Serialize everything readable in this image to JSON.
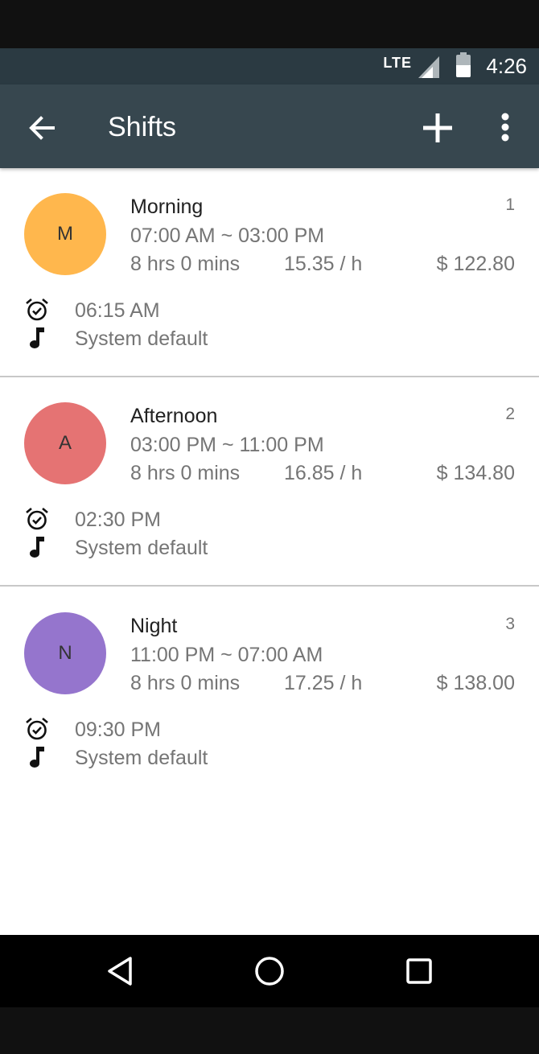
{
  "status_bar": {
    "network": "LTE",
    "time": "4:26"
  },
  "app_bar": {
    "title": "Shifts"
  },
  "shifts": [
    {
      "initial": "M",
      "name": "Morning",
      "index": "1",
      "time_range": "07:00 AM ~ 03:00 PM",
      "duration": "8 hrs 0 mins",
      "rate": "15.35 / h",
      "total": "$ 122.80",
      "alarm": "06:15 AM",
      "tone": "System default",
      "color": "#ffb74d"
    },
    {
      "initial": "A",
      "name": "Afternoon",
      "index": "2",
      "time_range": "03:00 PM ~ 11:00 PM",
      "duration": "8 hrs 0 mins",
      "rate": "16.85 / h",
      "total": "$ 134.80",
      "alarm": "02:30 PM",
      "tone": "System default",
      "color": "#e57373"
    },
    {
      "initial": "N",
      "name": "Night",
      "index": "3",
      "time_range": "11:00 PM ~ 07:00 AM",
      "duration": "8 hrs 0 mins",
      "rate": "17.25 / h",
      "total": "$ 138.00",
      "alarm": "09:30 PM",
      "tone": "System default",
      "color": "#9575cd"
    }
  ],
  "icons": {
    "back": "arrow-back-icon",
    "add": "plus-icon",
    "more": "more-vert-icon",
    "alarm": "alarm-check-icon",
    "tone": "music-note-icon",
    "nav_back": "triangle-back-icon",
    "nav_home": "circle-home-icon",
    "nav_recents": "square-recents-icon"
  },
  "colors": {
    "status_bar": "#2b3a42",
    "app_bar": "#37474f"
  }
}
